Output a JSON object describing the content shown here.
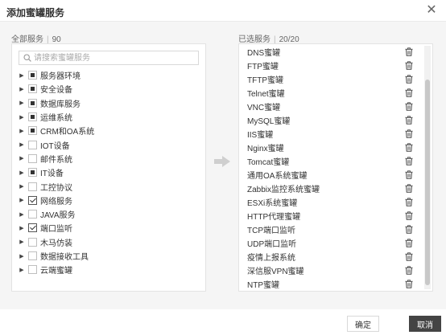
{
  "dialog": {
    "title": "添加蜜罐服务",
    "close_symbol": "✕"
  },
  "left": {
    "label": "全部服务",
    "count": "90",
    "search_placeholder": "请搜索蜜罐服务",
    "items": [
      {
        "label": "服务器环境",
        "state": "partial"
      },
      {
        "label": "安全设备",
        "state": "partial"
      },
      {
        "label": "数据库服务",
        "state": "partial"
      },
      {
        "label": "运维系统",
        "state": "partial"
      },
      {
        "label": "CRM和OA系统",
        "state": "partial"
      },
      {
        "label": "IOT设备",
        "state": "none"
      },
      {
        "label": "邮件系统",
        "state": "none"
      },
      {
        "label": "IT设备",
        "state": "partial"
      },
      {
        "label": "工控协议",
        "state": "none"
      },
      {
        "label": "网络服务",
        "state": "checked"
      },
      {
        "label": "JAVA服务",
        "state": "none"
      },
      {
        "label": "端口监听",
        "state": "checked"
      },
      {
        "label": "木马仿装",
        "state": "none"
      },
      {
        "label": "数据接收工具",
        "state": "none"
      },
      {
        "label": "云端蜜罐",
        "state": "none"
      }
    ]
  },
  "right": {
    "label": "已选服务",
    "count": "20/20",
    "items": [
      "DNS蜜罐",
      "FTP蜜罐",
      "TFTP蜜罐",
      "Telnet蜜罐",
      "VNC蜜罐",
      "MySQL蜜罐",
      "IIS蜜罐",
      "Nginx蜜罐",
      "Tomcat蜜罐",
      "通用OA系统蜜罐",
      "Zabbix监控系统蜜罐",
      "ESXi系统蜜罐",
      "HTTP代理蜜罐",
      "TCP端口监听",
      "UDP端口监听",
      "疫情上报系统",
      "深信服VPN蜜罐",
      "NTP蜜罐"
    ]
  },
  "footer": {
    "confirm_label": "确定",
    "cancel_label": "取消"
  },
  "colors": {
    "accent": "#444444",
    "checkbox_fill": "#333333",
    "panel_border": "#e3e3e3"
  }
}
